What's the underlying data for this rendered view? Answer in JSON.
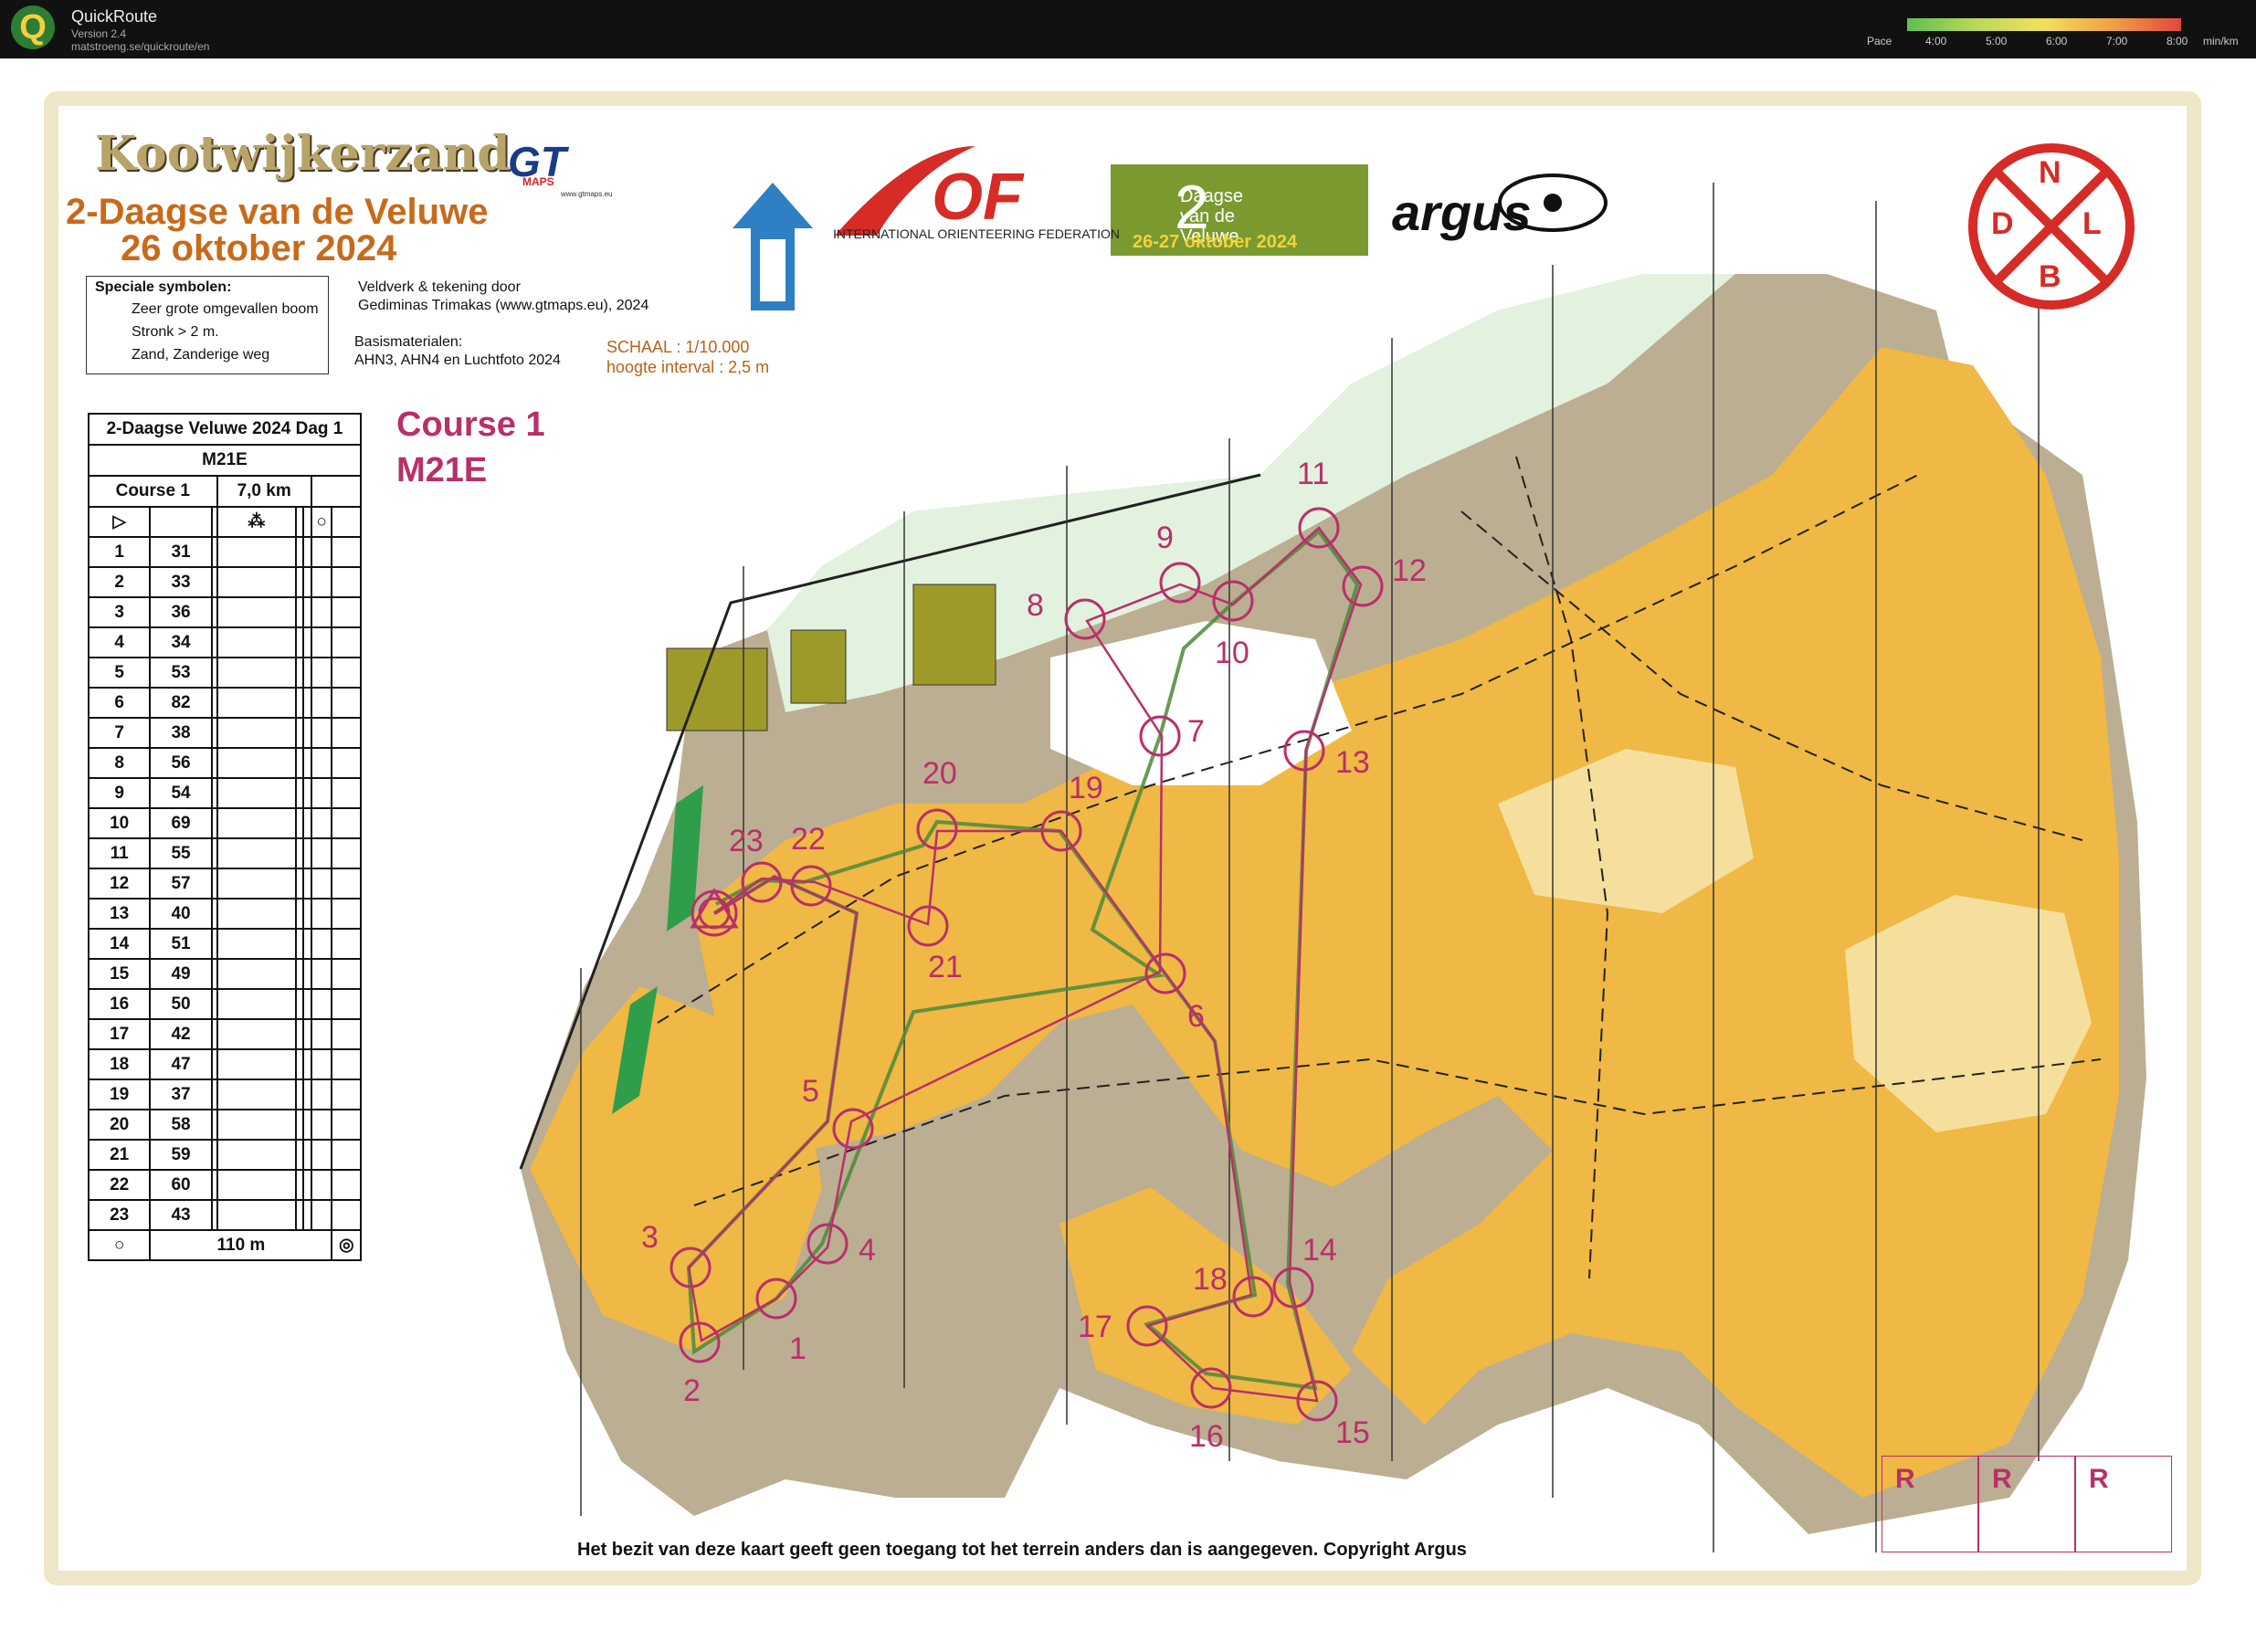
{
  "app": {
    "name": "QuickRoute",
    "version": "Version 2.4",
    "url": "matstroeng.se/quickroute/en"
  },
  "pace_legend": {
    "label": "Pace",
    "ticks": [
      "4:00",
      "5:00",
      "6:00",
      "7:00",
      "8:00"
    ],
    "unit": "min/km",
    "colors": [
      "#5fbf4f",
      "#b9d85a",
      "#f2e05a",
      "#f0a045",
      "#e0483a"
    ]
  },
  "map": {
    "area_name": "Kootwijkerzand",
    "event_title": "2-Daagse van de Veluwe",
    "event_date": "26 oktober 2024",
    "mapper_logo": "GT",
    "mapper_logo_sub": "MAPS",
    "mapper_logo_url": "www.gtmaps.eu",
    "special_symbols": {
      "title": "Speciale symbolen:",
      "items": [
        "Zeer grote omgevallen boom",
        "Stronk > 2 m.",
        "Zand, Zanderige weg"
      ]
    },
    "credits": [
      "Veldverk & tekening door",
      "Gediminas Trimakas (www.gtmaps.eu), 2024"
    ],
    "base_materials": [
      "Basismaterialen:",
      "AHN3, AHN4 en Luchtfoto 2024"
    ],
    "scale": "SCHAAL : 1/10.000",
    "contour": "hoogte interval : 2,5 m",
    "iof_logo": "OF",
    "iof_text": "INTERNATIONAL ORIENTEERING FEDERATION",
    "veluwe_logo": {
      "number": "2",
      "lines": [
        "Daagse",
        "van de",
        "Veluwe"
      ],
      "dates": "26-27 oktober 2024"
    },
    "argus_logo": "argus",
    "ndlb_logo": [
      "N",
      "D",
      "L",
      "B"
    ],
    "course_label": "Course 1",
    "class_label": "M21E",
    "copyright": "Het bezit van deze kaart geeft geen toegang tot het terrein anders dan is aangegeven. Copyright Argus",
    "r_boxes": [
      "R",
      "R",
      "R"
    ],
    "control_labels": [
      "1",
      "2",
      "3",
      "4",
      "5",
      "6",
      "7",
      "8",
      "9",
      "10",
      "11",
      "12",
      "13",
      "14",
      "15",
      "16",
      "17",
      "18",
      "19",
      "20",
      "21",
      "22",
      "23"
    ],
    "colors": {
      "course": "#b8306a",
      "forest": "#f0b844",
      "open": "#f6df9c",
      "rough": "#bcae92",
      "green": "#2f9e4a",
      "route": "#4a8a3a"
    }
  },
  "description": {
    "event_line": "2-Daagse Veluwe 2024 Dag 1",
    "class": "M21E",
    "course": "Course 1",
    "length": "7,0 km",
    "rows": [
      {
        "n": "1",
        "code": "31"
      },
      {
        "n": "2",
        "code": "33"
      },
      {
        "n": "3",
        "code": "36"
      },
      {
        "n": "4",
        "code": "34"
      },
      {
        "n": "5",
        "code": "53"
      },
      {
        "n": "6",
        "code": "82"
      },
      {
        "n": "7",
        "code": "38"
      },
      {
        "n": "8",
        "code": "56"
      },
      {
        "n": "9",
        "code": "54"
      },
      {
        "n": "10",
        "code": "69"
      },
      {
        "n": "11",
        "code": "55"
      },
      {
        "n": "12",
        "code": "57"
      },
      {
        "n": "13",
        "code": "40"
      },
      {
        "n": "14",
        "code": "51"
      },
      {
        "n": "15",
        "code": "49"
      },
      {
        "n": "16",
        "code": "50"
      },
      {
        "n": "17",
        "code": "42"
      },
      {
        "n": "18",
        "code": "47"
      },
      {
        "n": "19",
        "code": "37"
      },
      {
        "n": "20",
        "code": "58"
      },
      {
        "n": "21",
        "code": "59"
      },
      {
        "n": "22",
        "code": "60"
      },
      {
        "n": "23",
        "code": "43"
      }
    ],
    "finish": "110 m"
  }
}
